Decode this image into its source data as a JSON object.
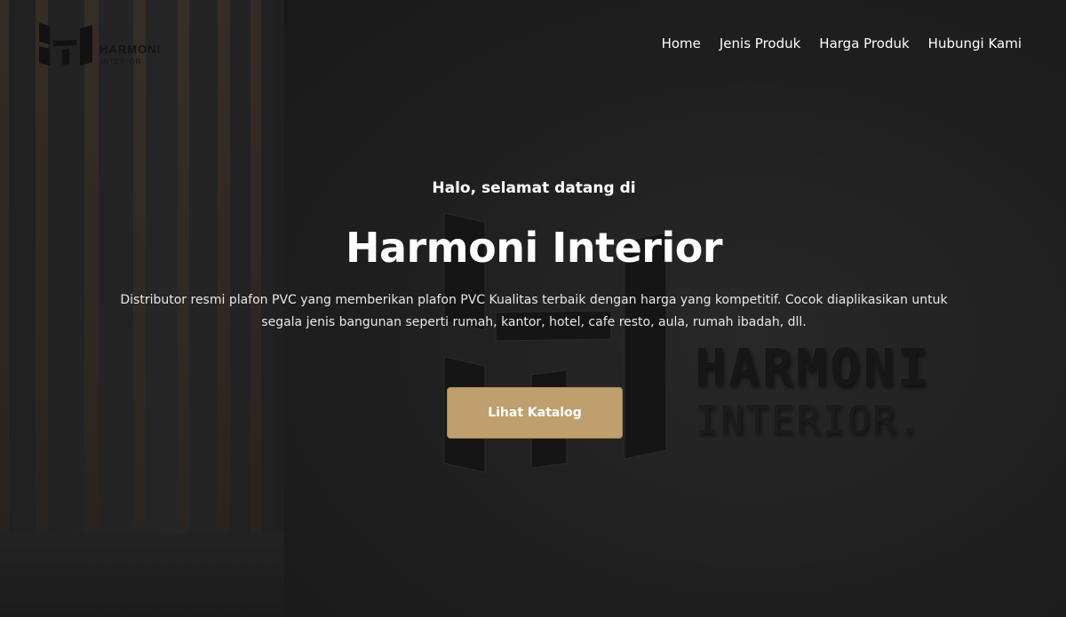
{
  "brand": {
    "name": "HARMONI",
    "sub": "INTERIOR"
  },
  "nav": {
    "items": [
      {
        "label": "Home"
      },
      {
        "label": "Jenis Produk"
      },
      {
        "label": "Harga Produk"
      },
      {
        "label": "Hubungi Kami"
      }
    ]
  },
  "hero": {
    "greeting": "Halo, selamat datang di",
    "title": "Harmoni Interior",
    "description": "Distributor resmi plafon PVC yang memberikan plafon PVC Kualitas terbaik dengan harga yang kompetitif. Cocok diaplikasikan untuk segala jenis bangunan seperti rumah, kantor, hotel, cafe resto, aula, rumah ibadah, dll.",
    "cta_label": "Lihat Katalog",
    "background_wall_text": {
      "line1": "HARMONI",
      "line2": "INTERIOR."
    }
  },
  "colors": {
    "accent": "#bf9f6e",
    "text": "#ffffff",
    "background": "#2a2a2a"
  }
}
